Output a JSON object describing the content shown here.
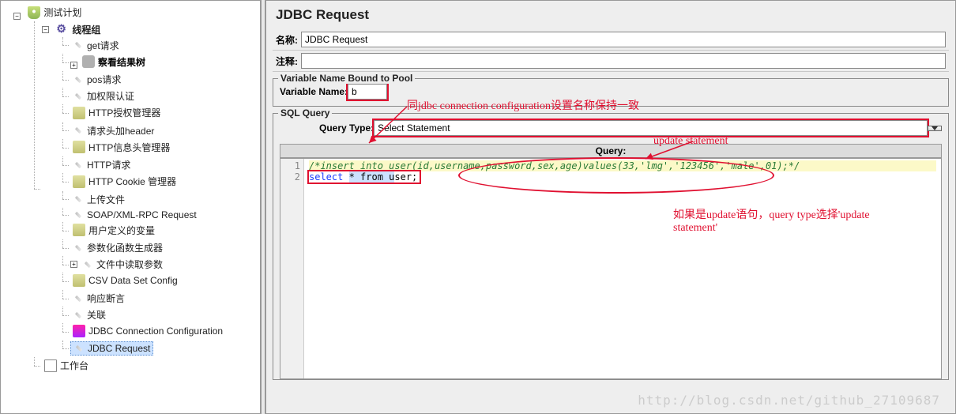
{
  "tree": {
    "root": "测试计划",
    "thread_group": "线程组",
    "nodes": {
      "get": "get请求",
      "view_results": "察看结果树",
      "pos": "pos请求",
      "auth": "加权限认证",
      "http_auth_mgr": "HTTP授权管理器",
      "header": "请求头加header",
      "header_mgr": "HTTP信息头管理器",
      "http_req": "HTTP请求",
      "cookie_mgr": "HTTP Cookie 管理器",
      "upload": "上传文件",
      "soap": "SOAP/XML-RPC Request",
      "user_var": "用户定义的变量",
      "param_gen": "参数化函数生成器",
      "file_read": "文件中读取参数",
      "csv": "CSV Data Set Config",
      "assert": "响应断言",
      "correlate": "关联",
      "jdbc_conn": "JDBC Connection Configuration",
      "jdbc_req": "JDBC Request"
    },
    "workbench": "工作台"
  },
  "editor": {
    "title": "JDBC Request",
    "name_label": "名称:",
    "name_value": "JDBC Request",
    "comment_label": "注释:",
    "comment_value": "",
    "var_group": "Variable Name Bound to Pool",
    "var_label": "Variable Name:",
    "var_value": "b",
    "sql_group": "SQL Query",
    "query_type_label": "Query Type:",
    "query_type_value": "Select Statement",
    "query_header": "Query:",
    "code": {
      "line1": "/*insert into user(id,username,password,sex,age)values(33,'lmg','123456','male',01);*/",
      "line2_pre": "select ",
      "line2_sel": "* from u",
      "line2_post": "ser;"
    }
  },
  "annotations": {
    "a1": "同jdbc connection configuration设置名称保持一致",
    "a2": "update statement",
    "a3": "如果是update语句，query type选择'update statement'"
  },
  "watermark": "http://blog.csdn.net/github_27109687"
}
